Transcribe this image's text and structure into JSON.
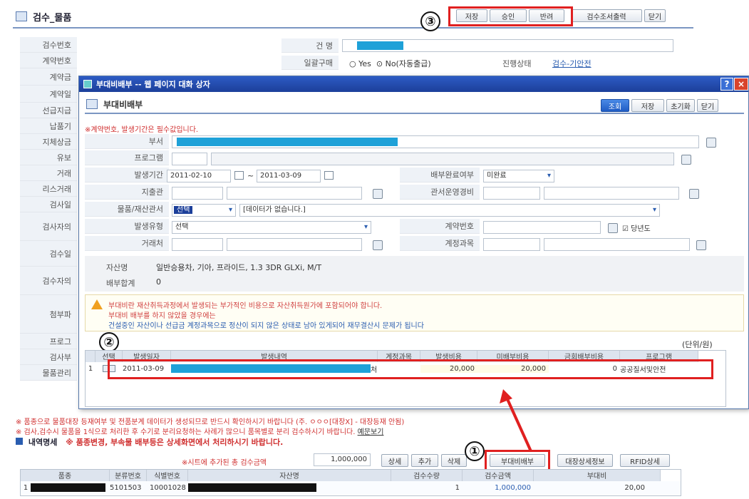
{
  "bg": {
    "title": "검수_물품",
    "labels": [
      "검수번호",
      "계약번호",
      "계약금",
      "계약일",
      "선급지급",
      "납품기",
      "지체상금",
      "유보",
      "거래",
      "리스거래",
      "검사일",
      "검사자의",
      "검수일",
      "검수자의",
      "첨부파",
      "프로그",
      "검사부",
      "물품관리"
    ],
    "name_label": "건 명",
    "bulk_label": "일괄구매",
    "yes": "Yes",
    "no": "No(자동출급)",
    "status_label": "진행상태",
    "status_value": "검수-기안전",
    "btn_save": "저장",
    "btn_approve": "승인",
    "btn_return": "반려",
    "btn_print": "검수조서출력",
    "btn_close": "닫기",
    "notice1": "※ 품종으로 물품대장 등재여부 및 전품분계 데이터가 생성되므로 반드시 확인하시기 바랍니다 (주. ㅇㅇㅇ[대장X] - 대장등재 안됨)",
    "notice2": "※ 검사,검수시 물품을 1식으로 처리한 후 수기로 분리요청하는 사례가 많으니 품목별로 분리 검수하시기 바랍니다.",
    "notice2_link": "예문보기",
    "detail_label": "내역명세",
    "detail_warn": "※ 품종변경, 부속물 배부등은 상세화면에서 처리하시기 바랍니다.",
    "total_label": "※시트에 추가된 총 검수금액",
    "total_value": "1,000,000",
    "btn_detail": "상세",
    "btn_add": "추가",
    "btn_delete": "삭제",
    "btn_allocate": "부대비배부",
    "btn_ledger": "대장상세정보",
    "btn_rfid": "RFID상세",
    "grid_headers": [
      "품종",
      "분류번호",
      "식별번호",
      "자산명",
      "검수수량",
      "검수금액",
      "부대비"
    ],
    "grid_row": {
      "no": "1",
      "class_no": "5101503",
      "id_no": "10001028",
      "qty": "1",
      "amount": "1,000,000",
      "extra": "20,00"
    }
  },
  "dlg": {
    "title": "부대비배부 -- 웹 페이지 대화 상자",
    "heading": "부대비배부",
    "required": "※계약번호, 발생기간은 필수값입니다.",
    "btn_search": "조회",
    "btn_save": "저장",
    "btn_reset": "초기화",
    "btn_close": "닫기",
    "lbl_dept": "부서",
    "lbl_program": "프로그램",
    "lbl_period": "발생기간",
    "period_from": "2011-02-10",
    "period_sep": "~",
    "period_to": "2011-03-09",
    "lbl_alloc": "배부완료여부",
    "alloc_value": "미완료",
    "lbl_payer": "지출관",
    "lbl_opcost": "관서운영경비",
    "lbl_asset_office": "물품/재산관서",
    "asset_office_sel": "선택",
    "asset_office_msg": "[데이터가 없습니다.]",
    "lbl_type": "발생유형",
    "type_value": "선택",
    "lbl_contract": "계약번호",
    "thisyear": "당년도",
    "lbl_vendor": "거래처",
    "lbl_account": "계정과목",
    "lbl_asset": "자산명",
    "asset_value": "일반승용차, 기아, 프라이드, 1.3 3DR GLXi, M/T",
    "lbl_sum": "배부합계",
    "sum_value": "0",
    "warn1": "부대비란 재산취득과정에서 발생되는 부가적인 비용으로 자산취득원가에 포함되어야 합니다.",
    "warn2": "부대비 배부를 하지 않았을 경우에는",
    "warn3": "건설중인 자산이나 선급금 계정과목으로 정산이 되지 않은 상태로 남아 있게되어 재무결산시 문제가 됩니다",
    "unit": "(단위/원)",
    "headers": [
      "선택",
      "발생일자",
      "발생내역",
      "계정과목",
      "발생비용",
      "미배부비용",
      "금회배부비용",
      "프로그램"
    ],
    "row": {
      "no": "1",
      "date": "2011-03-09",
      "suffix": "처",
      "cost": "20,000",
      "unalloc": "20,000",
      "this_alloc": "0",
      "program": "공공질서및안전"
    }
  },
  "markers": {
    "m1": "①",
    "m2": "②",
    "m3": "③"
  },
  "colors": {
    "accent": "#1ea1d8",
    "highlight": "#e02020"
  }
}
